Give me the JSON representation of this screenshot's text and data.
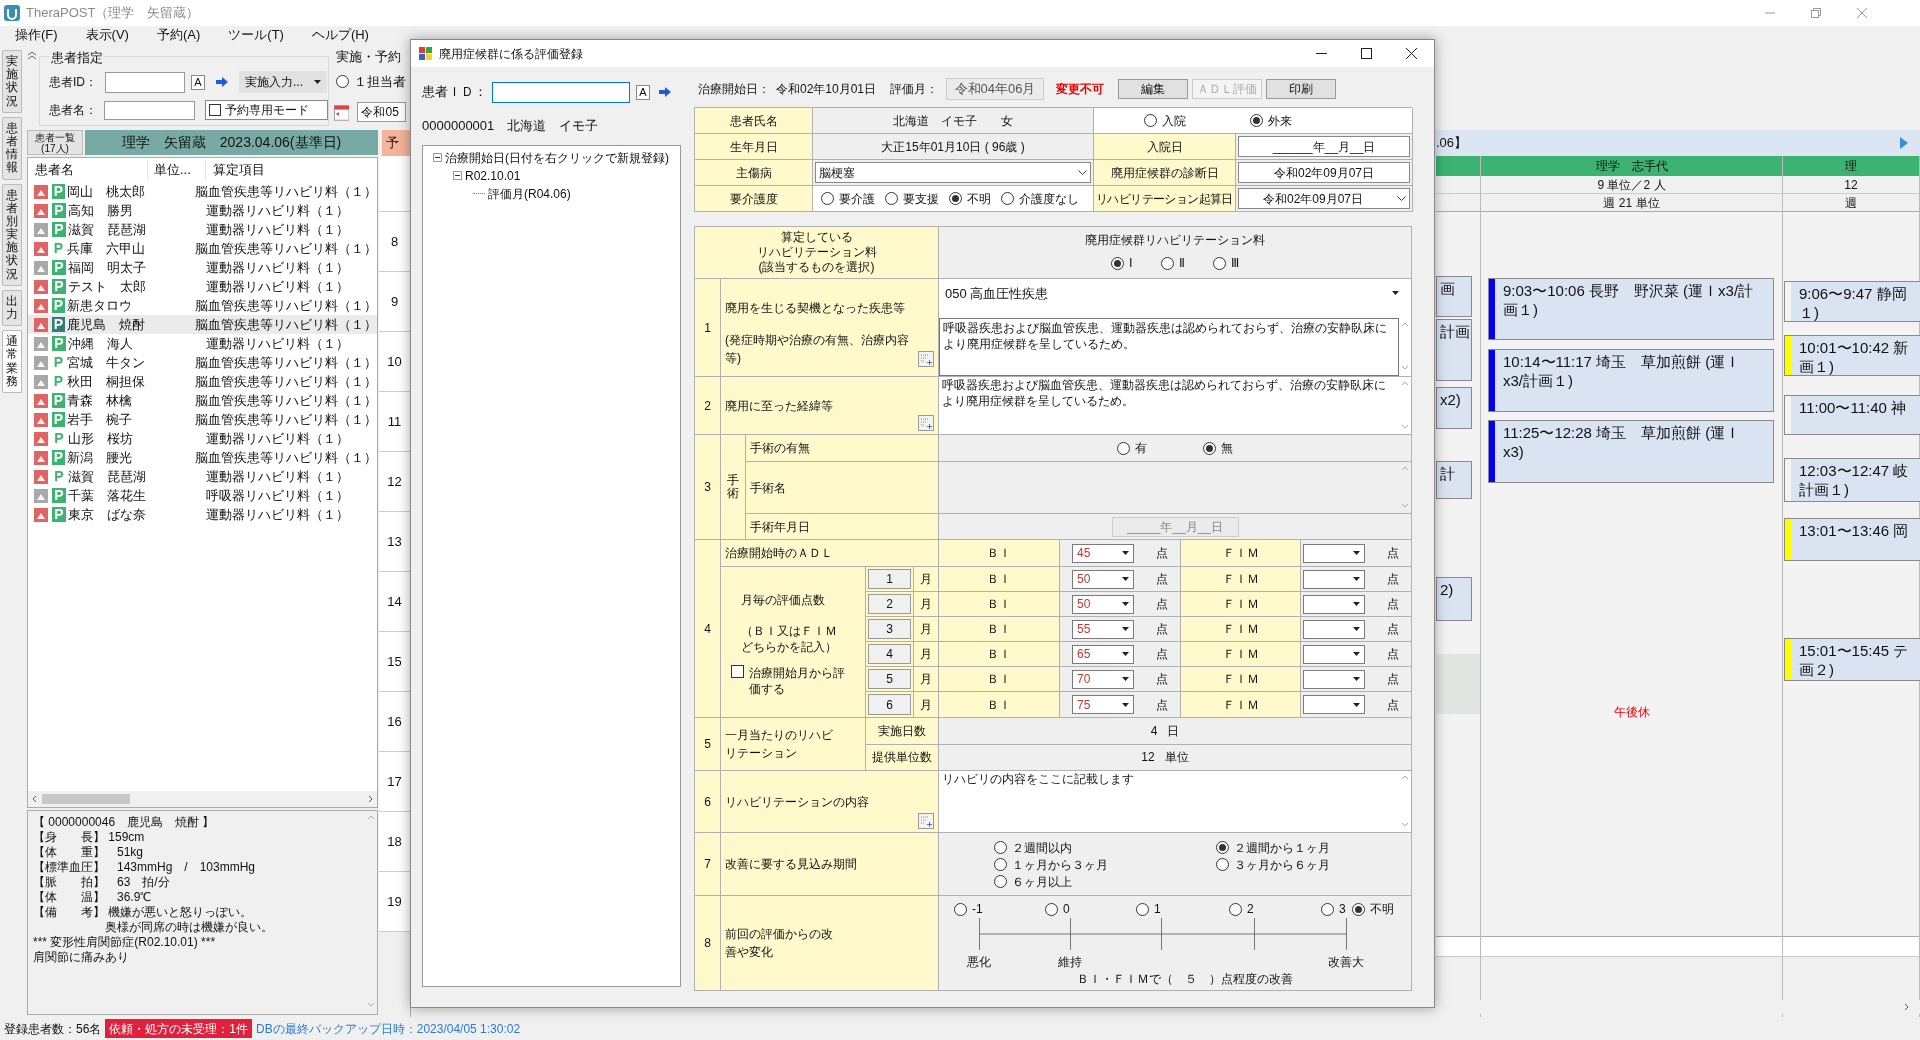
{
  "app": {
    "title": "TheraPOST（理学　矢留蔵）",
    "menu": [
      "操作(F)",
      "表示(V)",
      "予約(A)",
      "ツール(T)",
      "ヘルプ(H)"
    ]
  },
  "side_tabs": [
    {
      "label": "実施状況",
      "selected": false
    },
    {
      "label": "患者情報",
      "selected": false
    },
    {
      "label": "患者別実施状況",
      "selected": false
    },
    {
      "label": "出力",
      "selected": false
    },
    {
      "label": "通常業務",
      "selected": true
    }
  ],
  "patient_search": {
    "title": "患者指定",
    "id_label": "患者ID：",
    "id_button": "A",
    "mode_button": "実施入力...",
    "name_label": "患者名：",
    "reserve_mode": {
      "label": "予約専用モード",
      "checked": false
    }
  },
  "view_options": {
    "title": "実施・予約",
    "radio": {
      "label": "１担当者",
      "selected": false
    },
    "date": "令和05"
  },
  "list_header": {
    "count_lines": [
      "患者一覧",
      "(17人)"
    ],
    "title": "理学　矢留蔵　2023.04.06(基準日)"
  },
  "patients": {
    "columns": [
      "患者名",
      "単位...",
      "算定項目"
    ],
    "rows": [
      {
        "name": "岡山　桃太郎",
        "item": "脳血管疾患等リハビリ料（１）",
        "color": "#e06464",
        "badge": "P",
        "badge_filled": true,
        "selected": false
      },
      {
        "name": "高知　勝男",
        "item": "運動器リハビリ料（１）",
        "color": "#e06464",
        "badge": "P",
        "badge_filled": true,
        "selected": false
      },
      {
        "name": "滋賀　琵琶湖",
        "item": "運動器リハビリ料（１）",
        "color": "#a8a8a8",
        "badge": "P",
        "badge_filled": true,
        "selected": false
      },
      {
        "name": "兵庫　六甲山",
        "item": "脳血管疾患等リハビリ料（１）",
        "color": "#e06464",
        "badge": "P",
        "badge_filled": false,
        "selected": false
      },
      {
        "name": "福岡　明太子",
        "item": "運動器リハビリ料（１）",
        "color": "#a8a8a8",
        "badge": "P",
        "badge_filled": true,
        "selected": false
      },
      {
        "name": "テスト　太郎",
        "item": "運動器リハビリ料（１）",
        "color": "#e06464",
        "badge": "P",
        "badge_filled": true,
        "selected": false
      },
      {
        "name": "新患タロウ",
        "item": "脳血管疾患等リハビリ料（１）",
        "color": "#e06464",
        "badge": "P",
        "badge_filled": true,
        "selected": false
      },
      {
        "name": "鹿児島　焼酎",
        "item": "脳血管疾患等リハビリ料（１）",
        "color": "#e06464",
        "badge": "P",
        "badge_filled": true,
        "selected": true
      },
      {
        "name": "沖縄　海人",
        "item": "運動器リハビリ料（１）",
        "color": "#a8a8a8",
        "badge": "P",
        "badge_filled": true,
        "selected": false
      },
      {
        "name": "宮城　牛タン",
        "item": "脳血管疾患等リハビリ料（１）",
        "color": "#a8a8a8",
        "badge": "P",
        "badge_filled": false,
        "selected": false
      },
      {
        "name": "秋田　桐担保",
        "item": "脳血管疾患等リハビリ料（１）",
        "color": "#a8a8a8",
        "badge": "P",
        "badge_filled": false,
        "selected": false
      },
      {
        "name": "青森　林檎",
        "item": "脳血管疾患等リハビリ料（１）",
        "color": "#e06464",
        "badge": "P",
        "badge_filled": true,
        "selected": false
      },
      {
        "name": "岩手　椀子",
        "item": "脳血管疾患等リハビリ料（１）",
        "color": "#e06464",
        "badge": "P",
        "badge_filled": true,
        "selected": false
      },
      {
        "name": "山形　桜坊",
        "item": "運動器リハビリ料（１）",
        "color": "#e06464",
        "badge": "P",
        "badge_filled": false,
        "selected": false
      },
      {
        "name": "新潟　腰光",
        "item": "脳血管疾患等リハビリ料（１）",
        "color": "#e06464",
        "badge": "P",
        "badge_filled": true,
        "selected": false
      },
      {
        "name": "滋賀　琵琶湖",
        "item": "運動器リハビリ料（１）",
        "color": "#e06464",
        "badge": "P",
        "badge_filled": false,
        "selected": false
      },
      {
        "name": "千葉　落花生",
        "item": "呼吸器リハビリ料（１）",
        "color": "#a8a8a8",
        "badge": "P",
        "badge_filled": true,
        "selected": false
      },
      {
        "name": "東京　ばな奈",
        "item": "運動器リハビリ料（１）",
        "color": "#e06464",
        "badge": "P",
        "badge_filled": true,
        "selected": false
      }
    ]
  },
  "patient_info": [
    "【 0000000046　鹿児島　焼酎 】",
    "【身　　長】 159cm",
    "【体　　重】　51kg",
    "【標準血圧】　143mmHg　/　103mmHg",
    "【脈　　拍】　63　拍/分",
    "【体　　温】　36.9℃",
    "【備　　考】 機嫌が悪いと怒りっぽい。",
    "　　　　　　奥様が同席の時は機嫌が良い。",
    "*** 変形性肩関節症(R02.10.01) ***",
    "肩関節に痛みあり"
  ],
  "hours": [
    "8",
    "9",
    "10",
    "11",
    "12",
    "13",
    "14",
    "15",
    "16",
    "17",
    "18",
    "19"
  ],
  "calendar": {
    "reserve_tab": "予",
    "range_label": ".06】",
    "columns": [
      {
        "blocked": true,
        "cards": [
          {
            "lines": [
              "画"
            ]
          },
          {
            "lines": [
              "計画"
            ]
          },
          {
            "lines": [
              "x2)"
            ]
          },
          {
            "lines": [
              "計"
            ]
          },
          {
            "lines": [
              "2)"
            ]
          }
        ]
      },
      {
        "title": "理学　志手代",
        "units": "9 単位／2 人",
        "week": "週 21 単位",
        "note": "午後休",
        "cards": [
          {
            "lines": [
              "9:03〜10:06 長野　野沢菜 (運Ｉx3/計",
              "画１)"
            ],
            "color": "#0000ff"
          },
          {
            "lines": [
              "10:14〜11:17 埼玉　草加煎餅 (運Ｉ",
              "x3/計画１)"
            ],
            "color": "#0000ff"
          },
          {
            "lines": [
              "11:25〜12:28 埼玉　草加煎餅 (運Ｉ",
              "x3)"
            ],
            "color": "#0000ff"
          }
        ]
      },
      {
        "title": "理",
        "units": "12",
        "week": "週",
        "cards": [
          {
            "lines": [
              "9:06〜9:47 静岡",
              "１)"
            ],
            "color": "#f4f4f4"
          },
          {
            "lines": [
              "10:01〜10:42 新",
              "画１)"
            ],
            "color": "#ffff00"
          },
          {
            "lines": [
              "11:00〜11:40 神"
            ],
            "color": "#f4f4f4"
          },
          {
            "lines": [
              "12:03〜12:47 岐",
              "計画１)"
            ],
            "color": "#f4f4f4"
          },
          {
            "lines": [
              "13:01〜13:46 岡"
            ],
            "color": "#ffff00"
          },
          {
            "lines": [
              "15:01〜15:45 テ",
              "画２)"
            ],
            "color": "#ffff00"
          }
        ]
      }
    ]
  },
  "status_bar": {
    "count": "登録患者数：56名",
    "alert": "依頼・処方の未受理：1件",
    "backup": "DBの最終バックアップ日時：2023/04/05 1:30:02"
  },
  "dialog": {
    "title": "廃用症候群に係る評価登録",
    "id_label": "患者ＩＤ：",
    "id_button": "A",
    "patient_line": "0000000001　北海道　イモ子",
    "tree": [
      {
        "label": "治療開始日(日付を右クリックで新規登録)",
        "expanded": true,
        "children": [
          {
            "label": "R02.10.01",
            "expanded": true,
            "children": [
              {
                "label": "評価月(R04.06)"
              }
            ]
          }
        ]
      }
    ],
    "header": {
      "start_label": "治療開始日：",
      "start_value": "令和02年10月01日",
      "month_label": "評価月：",
      "month_value": "令和04年06月",
      "locked": "変更不可",
      "buttons": [
        {
          "label": "編集",
          "disabled": false
        },
        {
          "label": "ＡＤＬ評価",
          "disabled": true
        },
        {
          "label": "印刷",
          "disabled": false
        }
      ]
    },
    "info": {
      "name_label": "患者氏名",
      "name": "北海道　イモ子　　女",
      "stay": [
        {
          "label": "入院",
          "selected": false
        },
        {
          "label": "外来",
          "selected": true
        }
      ],
      "birth_label": "生年月日",
      "birth": "大正15年01月10日 ( 96歳 )",
      "admit_label": "入院日",
      "admit": "______年__月__日",
      "disease_label": "主傷病",
      "disease": "脳梗塞",
      "diag_label": "廃用症候群の診断日",
      "diag": "令和02年09月07日",
      "care_label": "要介護度",
      "care": [
        {
          "label": "要介護",
          "selected": false
        },
        {
          "label": "要支援",
          "selected": false
        },
        {
          "label": "不明",
          "selected": true
        },
        {
          "label": "介護度なし",
          "selected": false
        }
      ],
      "rehab_start_label": "リハビリテーション起算日",
      "rehab_start": "令和02年09月07日"
    },
    "fee": {
      "label_lines": [
        "算定している",
        "リハビリテーション料",
        "(該当するものを選択)"
      ],
      "title": "廃用症候群リハビリテーション料",
      "options": [
        {
          "label": "Ⅰ",
          "selected": true
        },
        {
          "label": "Ⅱ",
          "selected": false
        },
        {
          "label": "Ⅲ",
          "selected": false
        }
      ]
    },
    "cause": {
      "no": "1",
      "label": "廃用を生じる契機となった疾患等",
      "sub": "(発症時期や治療の有無、治療内容等)",
      "disease": "050 高血圧性疾患",
      "text": "呼吸器疾患および脳血管疾患、運動器疾患は認められておらず、治療の安静臥床により廃用症候群を呈しているため。"
    },
    "course": {
      "no": "2",
      "label": "廃用に至った経緯等",
      "text": "呼吸器疾患および脳血管疾患、運動器疾患は認められておらず、治療の安静臥床により廃用症候群を呈しているため。"
    },
    "surgery": {
      "no": "3",
      "group": "手術",
      "presence_label": "手術の有無",
      "presence": [
        {
          "label": "有",
          "selected": false
        },
        {
          "label": "無",
          "selected": true
        }
      ],
      "name_label": "手術名",
      "date_label": "手術年月日",
      "date": "_____年__月__日"
    },
    "adl": {
      "no": "4",
      "start": {
        "label": "治療開始時のＡＤＬ",
        "bi_label": "ＢＩ",
        "bi": "45",
        "bi_unit": "点",
        "fim_label": "ＦＩＭ",
        "fim_unit": "点"
      },
      "monthly_label": "月毎の評価点数",
      "monthly_note": "（ＢＩ又はＦＩＭどちらかを記入）",
      "from_start": {
        "label": "治療開始月から評価する",
        "checked": false
      },
      "months": [
        {
          "no": "1",
          "unit": "月",
          "bi_label": "ＢＩ",
          "bi": "50",
          "bi_unit": "点",
          "fim_label": "ＦＩＭ",
          "fim_unit": "点"
        },
        {
          "no": "2",
          "unit": "月",
          "bi_label": "ＢＩ",
          "bi": "50",
          "bi_unit": "点",
          "fim_label": "ＦＩＭ",
          "fim_unit": "点"
        },
        {
          "no": "3",
          "unit": "月",
          "bi_label": "ＢＩ",
          "bi": "55",
          "bi_unit": "点",
          "fim_label": "ＦＩＭ",
          "fim_unit": "点"
        },
        {
          "no": "4",
          "unit": "月",
          "bi_label": "ＢＩ",
          "bi": "65",
          "bi_unit": "点",
          "fim_label": "ＦＩＭ",
          "fim_unit": "点"
        },
        {
          "no": "5",
          "unit": "月",
          "bi_label": "ＢＩ",
          "bi": "70",
          "bi_unit": "点",
          "fim_label": "ＦＩＭ",
          "fim_unit": "点"
        },
        {
          "no": "6",
          "unit": "月",
          "bi_label": "ＢＩ",
          "bi": "75",
          "bi_unit": "点",
          "fim_label": "ＦＩＭ",
          "fim_unit": "点"
        }
      ]
    },
    "frequency": {
      "no": "5",
      "label": "一月当たりのリハビリテーション",
      "rows": [
        {
          "label": "実施日数",
          "value": "4",
          "unit": "日"
        },
        {
          "label": "提供単位数",
          "value": "12",
          "unit": "単位"
        }
      ]
    },
    "content": {
      "no": "6",
      "label": "リハビリテーションの内容",
      "text": "リハビリの内容をここに記載します"
    },
    "period": {
      "no": "7",
      "label": "改善に要する見込み期間",
      "options": [
        {
          "label": "２週間以内",
          "selected": false
        },
        {
          "label": "２週間から１ヶ月",
          "selected": true
        },
        {
          "label": "１ヶ月から３ヶ月",
          "selected": false
        },
        {
          "label": "３ヶ月から６ヶ月",
          "selected": false
        },
        {
          "label": "６ヶ月以上",
          "selected": false
        }
      ]
    },
    "change": {
      "no": "8",
      "label": "前回の評価からの改善や変化",
      "scale": [
        {
          "label": "-1",
          "selected": false,
          "caption": "悪化"
        },
        {
          "label": "0",
          "selected": false,
          "caption": "維持"
        },
        {
          "label": "1",
          "selected": false
        },
        {
          "label": "2",
          "selected": false
        },
        {
          "label": "3",
          "selected": false,
          "caption": "改善大"
        }
      ],
      "unknown": {
        "label": "不明",
        "selected": true
      },
      "summary": "ＢＩ・ＦＩＭで（　５　）点程度の改善"
    }
  }
}
